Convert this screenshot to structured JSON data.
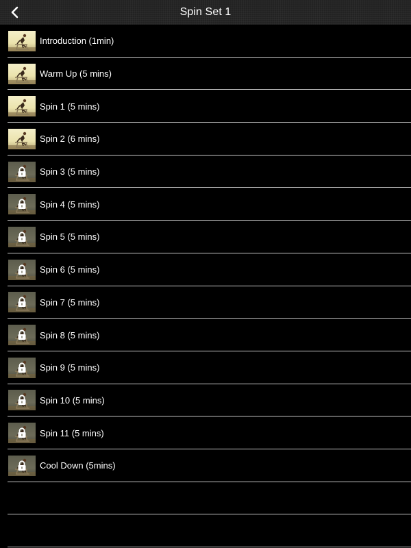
{
  "nav": {
    "title": "Spin Set 1",
    "back_icon": "chevron-left-icon"
  },
  "items": [
    {
      "label": "Introduction (1min)",
      "locked": false
    },
    {
      "label": "Warm Up (5 mins)",
      "locked": false
    },
    {
      "label": "Spin 1 (5 mins)",
      "locked": false
    },
    {
      "label": "Spin 2 (6 mins)",
      "locked": false
    },
    {
      "label": "Spin 3 (5 mins)",
      "locked": true
    },
    {
      "label": "Spin 4 (5 mins)",
      "locked": true
    },
    {
      "label": "Spin 5 (5 mins)",
      "locked": true
    },
    {
      "label": "Spin 6 (5 mins)",
      "locked": true
    },
    {
      "label": "Spin 7 (5 mins)",
      "locked": true
    },
    {
      "label": "Spin 8 (5 mins)",
      "locked": true
    },
    {
      "label": "Spin 9 (5 mins)",
      "locked": true
    },
    {
      "label": "Spin 10 (5 mins)",
      "locked": true
    },
    {
      "label": "Spin 11 (5 mins)",
      "locked": true
    },
    {
      "label": "Cool Down (5mins)",
      "locked": true
    }
  ],
  "empty_rows": 2,
  "colors": {
    "background": "#000000",
    "navbar": "#222222",
    "separator": "#c9c9c9",
    "text": "#ffffff"
  }
}
